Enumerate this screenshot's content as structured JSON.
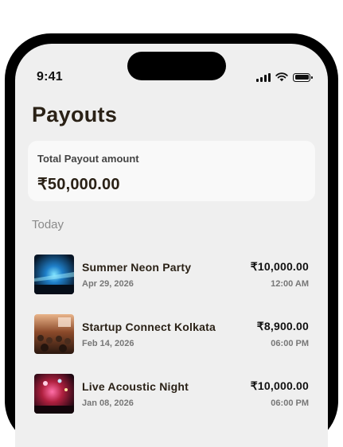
{
  "status": {
    "time": "9:41"
  },
  "page": {
    "title": "Payouts"
  },
  "total": {
    "label": "Total Payout amount",
    "amount": "₹50,000.00"
  },
  "section": {
    "label": "Today"
  },
  "payouts": [
    {
      "title": "Summer Neon Party",
      "date": "Apr 29, 2026",
      "amount": "₹10,000.00",
      "time": "12:00 AM"
    },
    {
      "title": "Startup Connect Kolkata",
      "date": "Feb 14, 2026",
      "amount": "₹8,900.00",
      "time": "06:00 PM"
    },
    {
      "title": "Live Acoustic Night",
      "date": "Jan 08, 2026",
      "amount": "₹10,000.00",
      "time": "06:00 PM"
    }
  ],
  "icons": [
    "signal-icon",
    "wifi-icon",
    "battery-icon"
  ],
  "colors": {
    "background": "#efefef",
    "card": "#f9f9f9",
    "text": "#2a2116",
    "muted": "#8a8a8a"
  }
}
